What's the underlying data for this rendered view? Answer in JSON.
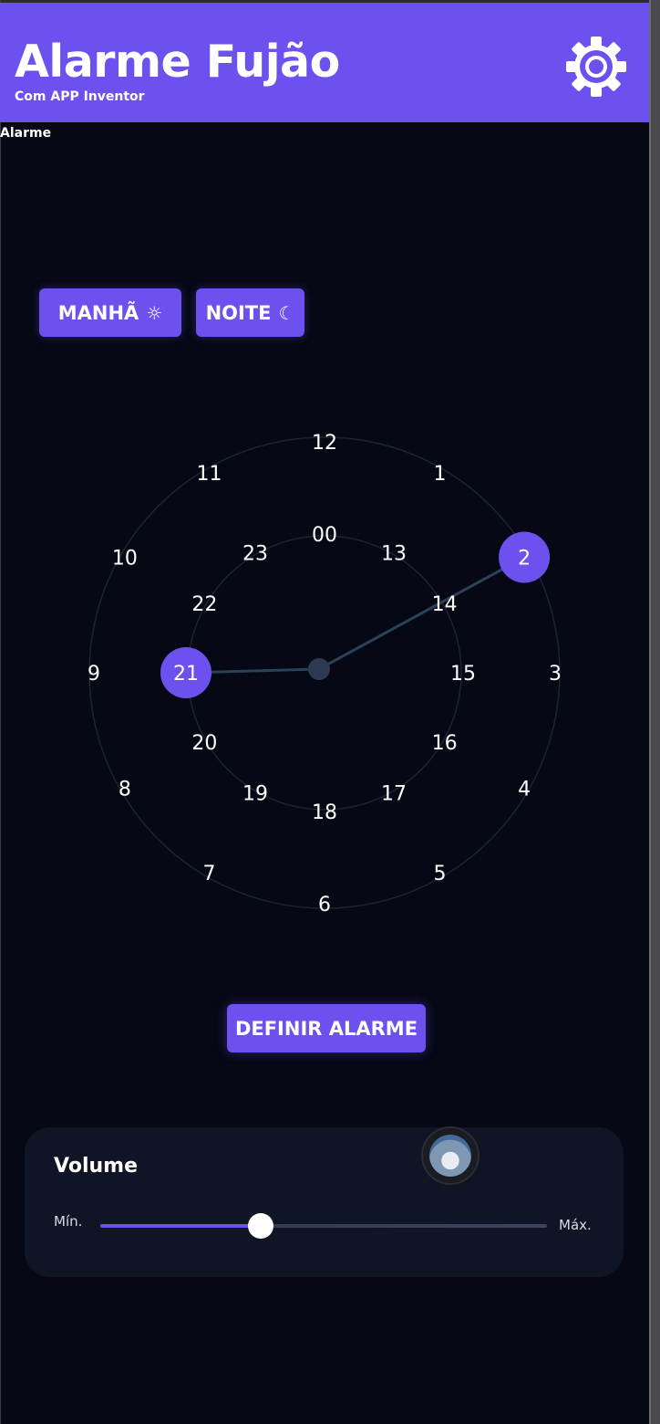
{
  "header": {
    "title": "Alarme Fujão",
    "subtitle": "Com APP Inventor",
    "settings_icon": "gear-icon"
  },
  "section_label": "Alarme",
  "modes": {
    "morning_label": "MANHÃ",
    "morning_icon": "☼",
    "night_label": "NOITE",
    "night_icon": "☾"
  },
  "clock": {
    "outer_numbers": [
      "12",
      "1",
      "2",
      "3",
      "4",
      "5",
      "6",
      "7",
      "8",
      "9",
      "10",
      "11"
    ],
    "inner_numbers": [
      "00",
      "13",
      "14",
      "15",
      "16",
      "17",
      "18",
      "19",
      "20",
      "21",
      "22",
      "23"
    ],
    "selected_minute_hand": "2",
    "selected_hour_hand": "21"
  },
  "actions": {
    "set_alarm_label": "DEFINIR ALARME"
  },
  "volume": {
    "title": "Volume",
    "min_label": "Mín.",
    "max_label": "Máx.",
    "level": 0.36
  },
  "colors": {
    "accent": "#6d51ef",
    "background": "#060815",
    "card": "#0f1525",
    "ring": "#252a3a",
    "hand": "#2a4258"
  }
}
